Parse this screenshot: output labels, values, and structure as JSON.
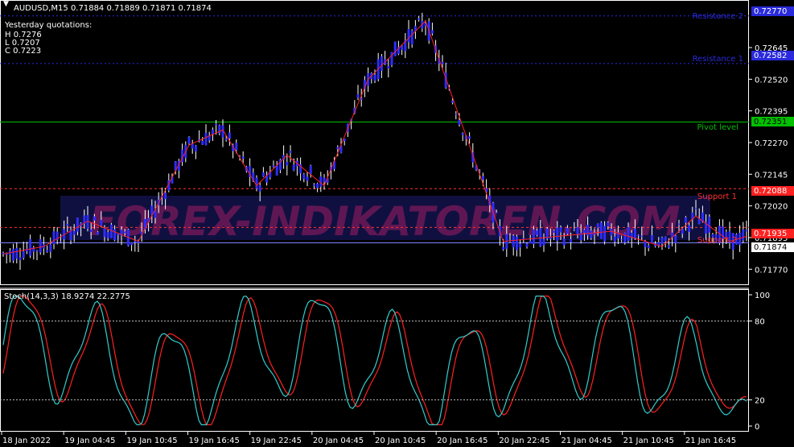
{
  "symbol_header": "AUDUSD,M15  0.71884 0.71889 0.71871 0.71874",
  "yesterday": {
    "title": "Yesterday quotations:",
    "high": "H 0.7276",
    "low": "L 0.7207",
    "close": "C 0.7223"
  },
  "watermark": "FOREX-INDIKATOREN.COM",
  "colors": {
    "background": "#000000",
    "candle_body": "#2d2dff",
    "candle_wick": "#ffffff",
    "zigzag": "#ff2020",
    "resistance": "#2a2adc",
    "pivot": "#00c000",
    "support": "#ff3030",
    "current": "#ffffff",
    "stoch_main": "#33cccc",
    "stoch_signal": "#ff2020"
  },
  "levels": {
    "resistance2": {
      "label": "Resistance 2",
      "price": "0.72770",
      "value": 0.7277
    },
    "resistance1": {
      "label": "Resistance 1",
      "price": "0.72582",
      "value": 0.72582
    },
    "pivot": {
      "label": "Pivot level",
      "price": "0.72351",
      "value": 0.72351
    },
    "support1": {
      "label": "Support 1",
      "price": "0.72088",
      "value": 0.72088
    },
    "support2": {
      "label": "Support 2",
      "price": "0.71935",
      "value": 0.71935
    },
    "current": {
      "price": "0.71874",
      "value": 0.71874
    }
  },
  "chart_data": [
    {
      "type": "line",
      "title": "AUDUSD,M15",
      "xlabel": "",
      "ylabel": "",
      "ylim": [
        0.7172,
        0.7282
      ],
      "y_ticks": [
        "0.72645",
        "0.72520",
        "0.72395",
        "0.72270",
        "0.72145",
        "0.72020",
        "0.71895",
        "0.71770"
      ],
      "y_tick_values": [
        0.72645,
        0.7252,
        0.72395,
        0.7227,
        0.72145,
        0.7202,
        0.71895,
        0.7177
      ],
      "x_labels": [
        "18 Jan 2022",
        "19 Jan 04:45",
        "19 Jan 10:45",
        "19 Jan 16:45",
        "19 Jan 22:45",
        "20 Jan 04:45",
        "20 Jan 10:45",
        "20 Jan 16:45",
        "20 Jan 22:45",
        "21 Jan 04:45",
        "21 Jan 10:45",
        "21 Jan 16:45"
      ],
      "series": [
        {
          "values_index": [
            0,
            12,
            25,
            40,
            55,
            65,
            75,
            84,
            95,
            108,
            125,
            148,
            180,
            195,
            205,
            215,
            220
          ],
          "values": [
            0.7183,
            0.7186,
            0.7196,
            0.7188,
            0.7226,
            0.7232,
            0.721,
            0.7222,
            0.721,
            0.7252,
            0.7275,
            0.7188,
            0.7192,
            0.7186,
            0.7198,
            0.7188,
            0.719
          ]
        }
      ]
    },
    {
      "type": "line",
      "title": "Stoch(14,3,3) 18.9274 22.2775",
      "ylim": [
        0,
        100
      ],
      "y_ticks": [
        "100",
        "80",
        "20",
        "0"
      ],
      "y_tick_values": [
        100,
        80,
        20,
        0
      ],
      "series": [
        {
          "values": [
            18.9274
          ]
        },
        {
          "values": [
            22.2775
          ]
        }
      ]
    }
  ]
}
